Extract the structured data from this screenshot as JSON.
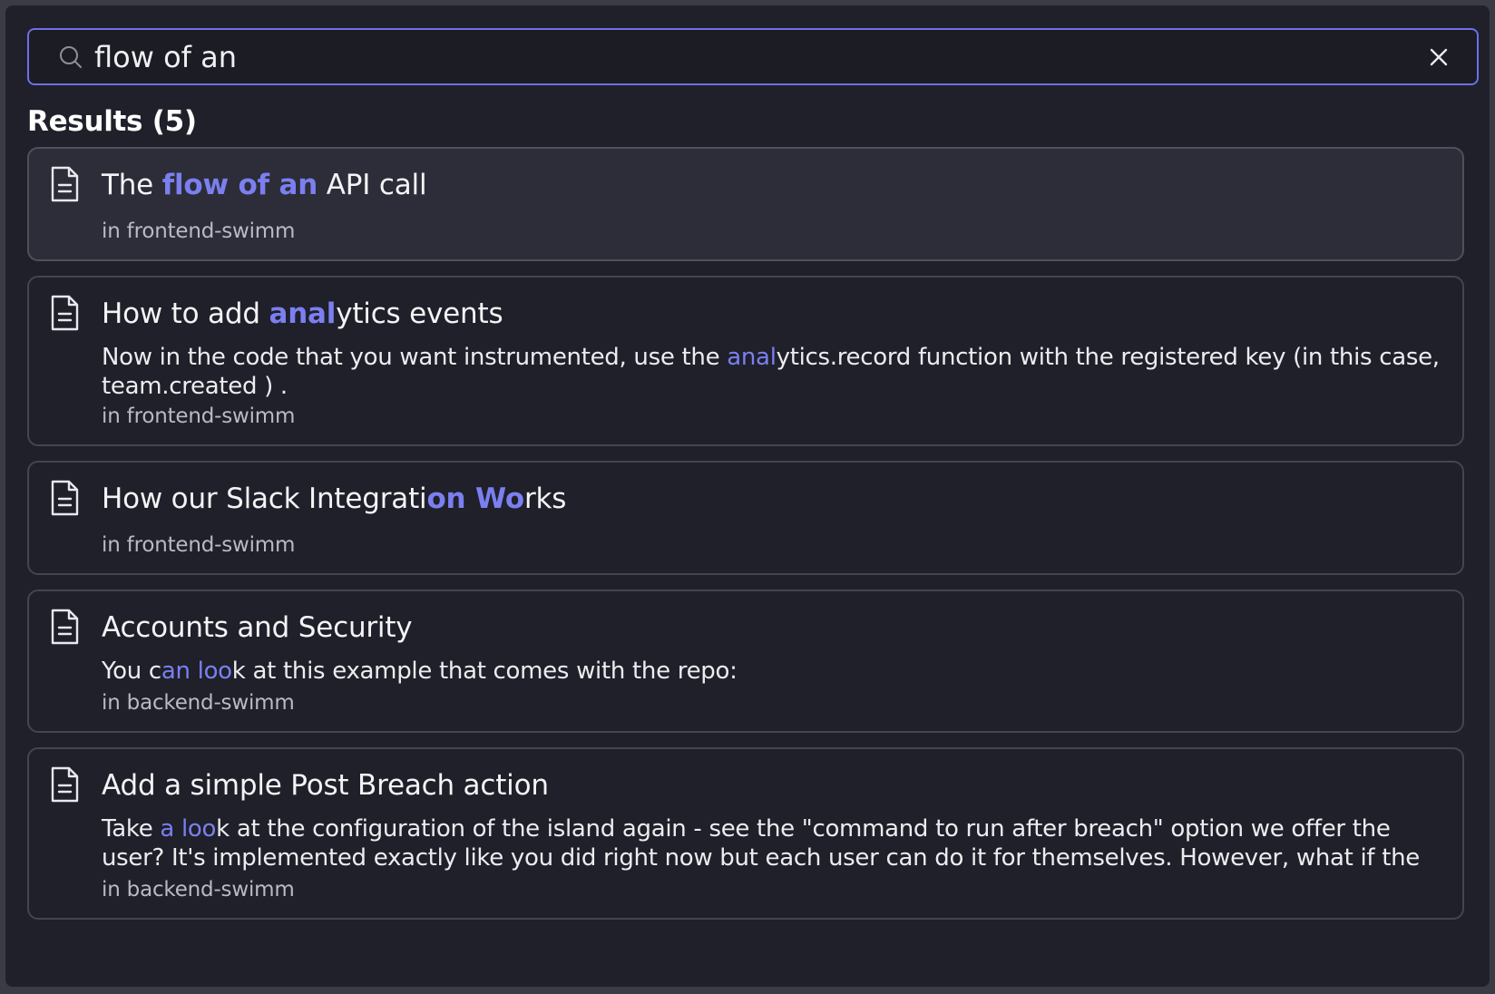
{
  "search": {
    "value": "flow of an",
    "placeholder": ""
  },
  "results": {
    "heading": "Results (5)",
    "items": [
      {
        "title_parts": [
          "The ",
          "flow of an",
          " API call"
        ],
        "snippet_parts": [],
        "repo": "in frontend-swimm"
      },
      {
        "title_parts": [
          "How to add ",
          "anal",
          "ytics events"
        ],
        "snippet_parts": [
          "Now in the code that you want instrumented, use the ",
          "anal",
          "ytics.record function with the registered key (in this case, team.created ) ."
        ],
        "repo": "in frontend-swimm"
      },
      {
        "title_parts": [
          "How our Slack Integrati",
          "on Wo",
          "rks"
        ],
        "snippet_parts": [],
        "repo": "in frontend-swimm"
      },
      {
        "title_parts": [
          "Accounts and Security",
          "",
          ""
        ],
        "snippet_parts": [
          "You c",
          "an loo",
          "k at this example that comes with the repo:"
        ],
        "repo": "in backend-swimm"
      },
      {
        "title_parts": [
          "Add a simple Post Breach action",
          "",
          ""
        ],
        "snippet_parts": [
          "Take ",
          "a loo",
          "k at the configuration of the island again - see the \"command to run after breach\" option we offer the user? It's implemented exactly like you did right now but each user can do it for themselves. However, what if the"
        ],
        "repo": "in backend-swimm"
      }
    ]
  },
  "colors": {
    "accent": "#7b7ff0",
    "background": "#1f2029",
    "selected_background": "#2c2d38",
    "border": "#44464f"
  },
  "icons": {
    "search": "search-icon",
    "clear": "close-icon",
    "document": "document-icon"
  }
}
